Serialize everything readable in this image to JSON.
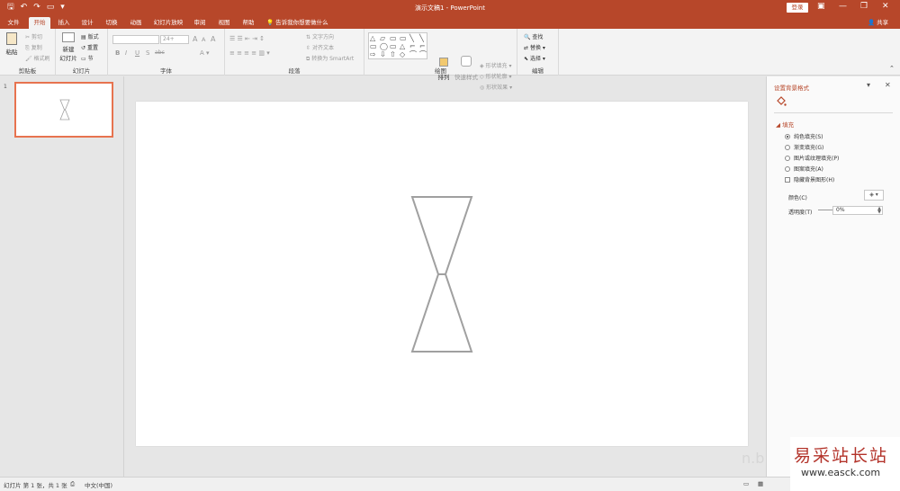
{
  "titlebar": {
    "title": "演示文稿1 - PowerPoint",
    "login": "登录",
    "qa_icons": [
      "save-icon",
      "undo-icon",
      "redo-icon",
      "start-from-beginning-icon",
      "customize-icon"
    ],
    "qa_glyphs": [
      "🖫",
      "↶",
      "↷",
      "▭",
      "▾"
    ],
    "win_glyphs": [
      "▣",
      "—",
      "❐",
      "✕"
    ]
  },
  "tabs": {
    "items": [
      {
        "label": "文件"
      },
      {
        "label": "开始"
      },
      {
        "label": "插入"
      },
      {
        "label": "设计"
      },
      {
        "label": "切换"
      },
      {
        "label": "动画"
      },
      {
        "label": "幻灯片放映"
      },
      {
        "label": "审阅"
      },
      {
        "label": "视图"
      },
      {
        "label": "帮助"
      }
    ],
    "active": "开始",
    "tell_me": "告诉我你想要做什么",
    "share": "共享"
  },
  "ribbon": {
    "clipboard": {
      "label": "剪贴板",
      "paste": "粘贴",
      "cut": "剪切",
      "copy": "复制",
      "format_painter": "格式刷"
    },
    "slides": {
      "label": "幻灯片",
      "new_slide": "新建",
      "new_slide_2": "幻灯片",
      "layout": "版式",
      "reset": "重置",
      "section": "节"
    },
    "font": {
      "label": "字体",
      "size": "24+",
      "bold": "B",
      "italic": "I",
      "underline": "U",
      "strike": "S",
      "shadow": "abc",
      "grow": "A",
      "shrink": "A",
      "clear": "A"
    },
    "paragraph": {
      "label": "段落",
      "text_direction": "文字方向",
      "align_text": "对齐文本",
      "smartart": "转换为 SmartArt"
    },
    "drawing": {
      "label": "绘图",
      "arrange": "排列",
      "quick_styles": "快速样式",
      "shape_fill": "形状填充",
      "shape_outline": "形状轮廓",
      "shape_effects": "形状效果",
      "shape_glyphs": [
        "△",
        "▱",
        "▭",
        "▭",
        "╲",
        "╲",
        "▭",
        "◯",
        "▭",
        "△",
        "⌐",
        "⌐",
        "⇨",
        "⇩",
        "⇧",
        "◇",
        "⌒",
        "⌒"
      ]
    },
    "editing": {
      "label": "编辑",
      "find": "查找",
      "replace": "替换",
      "select": "选择"
    }
  },
  "thumbnails": [
    {
      "number": "1"
    }
  ],
  "format_pane": {
    "title": "设置背景格式",
    "section": "填充",
    "fill_options": [
      {
        "label": "纯色填充(S)",
        "selected": true
      },
      {
        "label": "渐变填充(G)",
        "selected": false
      },
      {
        "label": "图片或纹理填充(P)",
        "selected": false
      },
      {
        "label": "图案填充(A)",
        "selected": false
      }
    ],
    "hide_graphics": "隐藏背景图形(H)",
    "color_label": "颜色(C)",
    "transparency_label": "透明度(T)",
    "transparency_value": "0%"
  },
  "statusbar": {
    "slide_info": "幻灯片 第 1 张，共 1 张",
    "language": "中文(中国)"
  },
  "watermark": {
    "brand": "易采站长站",
    "url": "www.easck.com"
  },
  "colors": {
    "accent": "#b7472a",
    "thumb_border": "#e7734f",
    "shape_stroke": "#a0a0a0"
  }
}
